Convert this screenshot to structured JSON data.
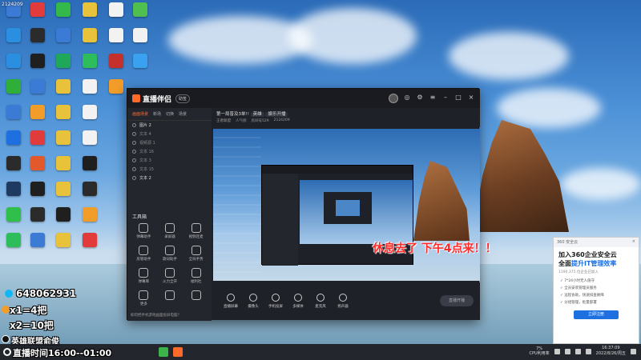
{
  "desktop": {
    "top_label": "2124209",
    "icons": [
      {
        "color": "#3b7bd6"
      },
      {
        "color": "#e23b3b"
      },
      {
        "color": "#35b84a"
      },
      {
        "color": "#e8c23a"
      },
      {
        "color": "#f2f2f2"
      },
      {
        "color": "#4fbf4f"
      },
      {
        "color": "#2a8fe0"
      },
      {
        "color": "#2b2b2b"
      },
      {
        "color": "#3b7bd6"
      },
      {
        "color": "#e8c23a"
      },
      {
        "color": "#f2f2f2"
      },
      {
        "color": "#f2f2f2"
      },
      {
        "color": "#2a8fe0"
      },
      {
        "color": "#1f1f1f"
      },
      {
        "color": "#1fa85a"
      },
      {
        "color": "#2ebd5b"
      },
      {
        "color": "#c4302b"
      },
      {
        "color": "#3aa0f0"
      },
      {
        "color": "#2fae3a"
      },
      {
        "color": "#3b7bd6"
      },
      {
        "color": "#e8c23a"
      },
      {
        "color": "#f2f2f2"
      },
      {
        "color": "#f29d2a"
      },
      {
        "color": "#3b7bd6"
      },
      {
        "color": "#f29d2a"
      },
      {
        "color": "#e8c23a"
      },
      {
        "color": "#f2f2f2"
      },
      {
        "color": "#1e6fe0"
      },
      {
        "color": "#e23b3b"
      },
      {
        "color": "#e8c23a"
      },
      {
        "color": "#f2f2f2"
      },
      {
        "color": "#2b2b2b"
      },
      {
        "color": "#e25a2b"
      },
      {
        "color": "#e8c23a"
      },
      {
        "color": "#1f1f1f"
      },
      {
        "color": "#1f3a60"
      },
      {
        "color": "#1f1f1f"
      },
      {
        "color": "#e8c23a"
      },
      {
        "color": "#2b2b2b"
      },
      {
        "color": "#2fbf4a"
      },
      {
        "color": "#2b2b2b"
      },
      {
        "color": "#1f1f1f"
      },
      {
        "color": "#f29d2a"
      },
      {
        "color": "#2ebd5b"
      },
      {
        "color": "#3b7bd6"
      },
      {
        "color": "#e8c23a"
      },
      {
        "color": "#e23b3b"
      }
    ]
  },
  "app": {
    "logo_text": "直播伴侣",
    "version_tag": "助签",
    "scene_tabs": [
      "画面场景",
      "新场",
      "切换",
      "场景"
    ],
    "layers": [
      {
        "label": "图片 2",
        "active": true
      },
      {
        "label": "文本 4",
        "active": false
      },
      {
        "label": "视频源 1",
        "active": false
      },
      {
        "label": "文本 16",
        "active": false
      },
      {
        "label": "文本 3",
        "active": false
      },
      {
        "label": "文本 15",
        "active": false
      },
      {
        "label": "文本 2",
        "active": true
      }
    ],
    "tools_title": "工具箱",
    "tools": [
      "弹幕助手",
      "录屏器",
      "视频连麦",
      "房管助手",
      "歌词助手",
      "全局手势",
      "弹幕库",
      "火力全开",
      "福利社",
      "更多",
      "",
      ""
    ],
    "bottom_tip": "如何把手机游戏画面投屏电脑？",
    "room_title": "第一局普及3单!!",
    "room_tag_game": "英雄",
    "room_tag_mode": "娱乐开播",
    "room_meta": [
      "王者联盟",
      "人气榜",
      "房间号529",
      "2124209"
    ],
    "toolbar_items": [
      "直播屏幕",
      "摄像头",
      "手机投屏",
      "多媒体",
      "麦克风",
      "扬声器"
    ],
    "start_button": "直播开播",
    "preview_overlay": "休息去了 下午4点来！！"
  },
  "ad": {
    "header_left": "360 安全云",
    "close": "×",
    "title_line1": "加入360企业安全云",
    "title_line2_prefix": "全面",
    "title_line2_highlight": "提升IT管理效率",
    "subtitle": "1190,375 位企业已加入",
    "features": [
      "7*24小时无人值守",
      "全员安装管理员服务",
      "远程协助，快速排查故障",
      "分组管理，批量部署"
    ],
    "button": "立即注册"
  },
  "overlay": {
    "qq": "648062931",
    "x1": "x1=4把",
    "x2": "x2=10把",
    "tiktok": "英雄联盟俞俊",
    "live_time": "直播时间16:00--01:00"
  },
  "taskbar": {
    "cpu_value": "7%",
    "cpu_label": "CPU利用率",
    "time": "16:37:09",
    "date": "2022/8/26/周五"
  }
}
